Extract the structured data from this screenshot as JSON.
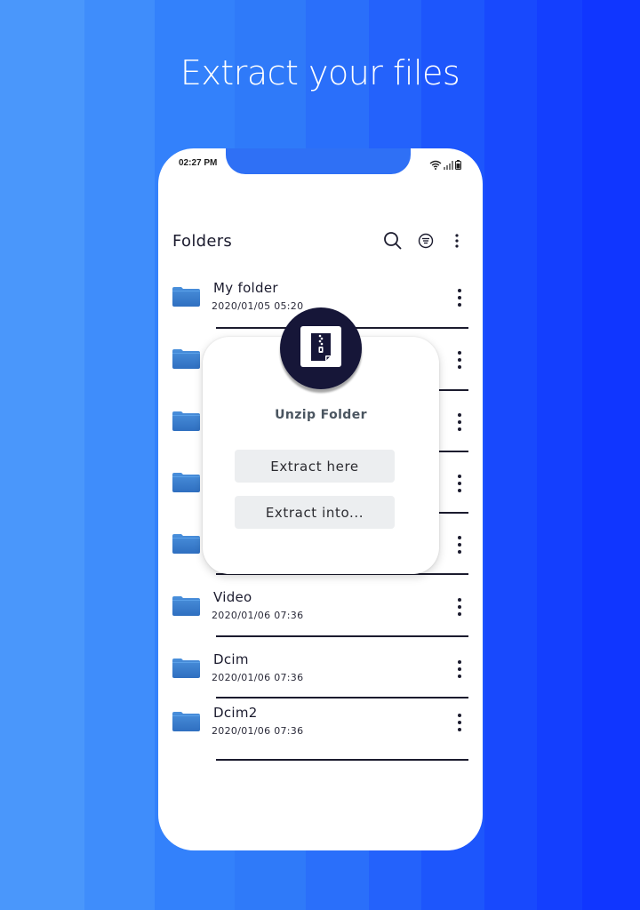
{
  "background": {
    "stripes": [
      "#4a97fb",
      "#3f8dfb",
      "#3381fb",
      "#2f7af9",
      "#2a6ffa",
      "#2462fb",
      "#1d56fc",
      "#1849fd",
      "#143ffe",
      "#1036ff"
    ]
  },
  "headline": "Extract your files",
  "status_bar": {
    "time": "02:27 PM",
    "icons": [
      "wifi-icon",
      "signal-icon",
      "battery-icon"
    ]
  },
  "header": {
    "title": "Folders",
    "actions": [
      "search-icon",
      "filter-icon",
      "more-vert-icon"
    ]
  },
  "folders": [
    {
      "name": "My folder",
      "date": "2020/01/05 05:20"
    },
    {
      "name": "",
      "date": ""
    },
    {
      "name": "",
      "date": ""
    },
    {
      "name": "",
      "date": ""
    },
    {
      "name": "",
      "date": ""
    },
    {
      "name": "Video",
      "date": "2020/01/06 07:36"
    },
    {
      "name": "Dcim",
      "date": "2020/01/06 07:36"
    },
    {
      "name": "Dcim2",
      "date": "2020/01/06 07:36"
    }
  ],
  "popup": {
    "icon": "zip-file-icon",
    "title": "Unzip Folder",
    "buttons": {
      "extract_here": "Extract here",
      "extract_into": "Extract into..."
    }
  },
  "colors": {
    "accent_dark": "#161638",
    "folder_blue": "#3a7fd0",
    "text_dark": "#1b1b2e",
    "button_bg": "#eceef0"
  }
}
